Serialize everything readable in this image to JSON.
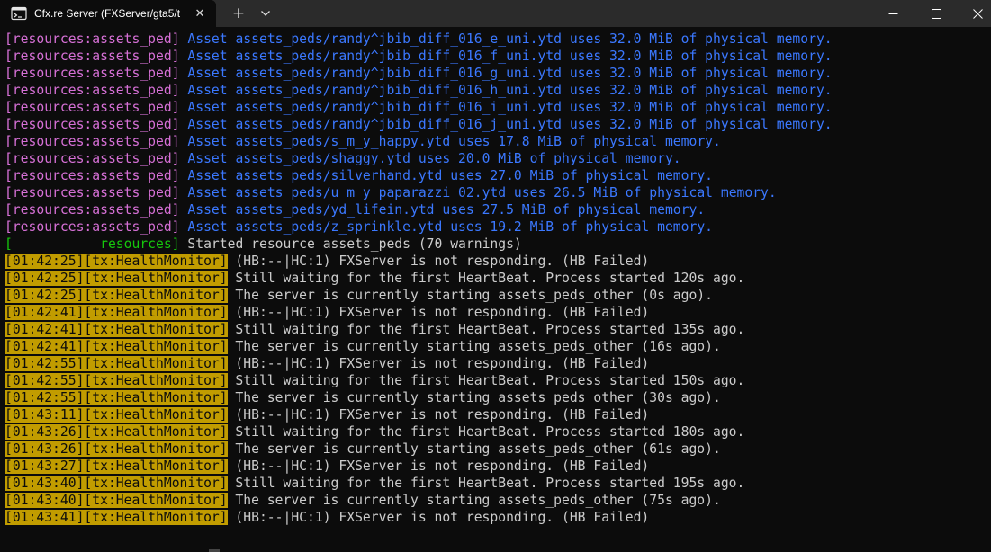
{
  "window": {
    "tab_title": "Cfx.re Server (FXServer/gta5/t",
    "close_glyph": "✕",
    "newtab_glyph": "+"
  },
  "colors": {
    "resource_tag": "#d670d6",
    "info_message": "#3b78ff",
    "started_tag": "#16c60c",
    "health_tag_bg": "#c19c00",
    "default_text": "#cccccc",
    "background": "#0c0c0c"
  },
  "icons": {
    "terminal": "terminal-icon",
    "close": "close-icon",
    "plus": "plus-icon",
    "chevron": "chevron-down-icon",
    "minimize": "minimize-icon",
    "maximize": "maximize-icon",
    "window_close": "window-close-icon"
  },
  "log": [
    {
      "tag": "[resources:assets_ped]",
      "tag_style": "res",
      "text": " Asset assets_peds/randy^jbib_diff_016_e_uni.ytd uses 32.0 MiB of physical memory.",
      "text_style": "blue"
    },
    {
      "tag": "[resources:assets_ped]",
      "tag_style": "res",
      "text": " Asset assets_peds/randy^jbib_diff_016_f_uni.ytd uses 32.0 MiB of physical memory.",
      "text_style": "blue"
    },
    {
      "tag": "[resources:assets_ped]",
      "tag_style": "res",
      "text": " Asset assets_peds/randy^jbib_diff_016_g_uni.ytd uses 32.0 MiB of physical memory.",
      "text_style": "blue"
    },
    {
      "tag": "[resources:assets_ped]",
      "tag_style": "res",
      "text": " Asset assets_peds/randy^jbib_diff_016_h_uni.ytd uses 32.0 MiB of physical memory.",
      "text_style": "blue"
    },
    {
      "tag": "[resources:assets_ped]",
      "tag_style": "res",
      "text": " Asset assets_peds/randy^jbib_diff_016_i_uni.ytd uses 32.0 MiB of physical memory.",
      "text_style": "blue"
    },
    {
      "tag": "[resources:assets_ped]",
      "tag_style": "res",
      "text": " Asset assets_peds/randy^jbib_diff_016_j_uni.ytd uses 32.0 MiB of physical memory.",
      "text_style": "blue"
    },
    {
      "tag": "[resources:assets_ped]",
      "tag_style": "res",
      "text": " Asset assets_peds/s_m_y_happy.ytd uses 17.8 MiB of physical memory.",
      "text_style": "blue"
    },
    {
      "tag": "[resources:assets_ped]",
      "tag_style": "res",
      "text": " Asset assets_peds/shaggy.ytd uses 20.0 MiB of physical memory.",
      "text_style": "blue"
    },
    {
      "tag": "[resources:assets_ped]",
      "tag_style": "res",
      "text": " Asset assets_peds/silverhand.ytd uses 27.0 MiB of physical memory.",
      "text_style": "blue"
    },
    {
      "tag": "[resources:assets_ped]",
      "tag_style": "res",
      "text": " Asset assets_peds/u_m_y_paparazzi_02.ytd uses 26.5 MiB of physical memory.",
      "text_style": "blue"
    },
    {
      "tag": "[resources:assets_ped]",
      "tag_style": "res",
      "text": " Asset assets_peds/yd_lifein.ytd uses 27.5 MiB of physical memory.",
      "text_style": "blue"
    },
    {
      "tag": "[resources:assets_ped]",
      "tag_style": "res",
      "text": " Asset assets_peds/z_sprinkle.ytd uses 19.2 MiB of physical memory.",
      "text_style": "blue"
    },
    {
      "tag": "[           resources]",
      "tag_style": "green",
      "text": " Started resource assets_peds (70 warnings)",
      "text_style": "white"
    },
    {
      "tag": "[01:42:25][tx:HealthMonitor]",
      "tag_style": "hm",
      "text": " (HB:--|HC:1) FXServer is not responding. (HB Failed)",
      "text_style": "white"
    },
    {
      "tag": "[01:42:25][tx:HealthMonitor]",
      "tag_style": "hm",
      "text": " Still waiting for the first HeartBeat. Process started 120s ago.",
      "text_style": "white"
    },
    {
      "tag": "[01:42:25][tx:HealthMonitor]",
      "tag_style": "hm",
      "text": " The server is currently starting assets_peds_other (0s ago).",
      "text_style": "white"
    },
    {
      "tag": "[01:42:41][tx:HealthMonitor]",
      "tag_style": "hm",
      "text": " (HB:--|HC:1) FXServer is not responding. (HB Failed)",
      "text_style": "white"
    },
    {
      "tag": "[01:42:41][tx:HealthMonitor]",
      "tag_style": "hm",
      "text": " Still waiting for the first HeartBeat. Process started 135s ago.",
      "text_style": "white"
    },
    {
      "tag": "[01:42:41][tx:HealthMonitor]",
      "tag_style": "hm",
      "text": " The server is currently starting assets_peds_other (16s ago).",
      "text_style": "white"
    },
    {
      "tag": "[01:42:55][tx:HealthMonitor]",
      "tag_style": "hm",
      "text": " (HB:--|HC:1) FXServer is not responding. (HB Failed)",
      "text_style": "white"
    },
    {
      "tag": "[01:42:55][tx:HealthMonitor]",
      "tag_style": "hm",
      "text": " Still waiting for the first HeartBeat. Process started 150s ago.",
      "text_style": "white"
    },
    {
      "tag": "[01:42:55][tx:HealthMonitor]",
      "tag_style": "hm",
      "text": " The server is currently starting assets_peds_other (30s ago).",
      "text_style": "white"
    },
    {
      "tag": "[01:43:11][tx:HealthMonitor]",
      "tag_style": "hm",
      "text": " (HB:--|HC:1) FXServer is not responding. (HB Failed)",
      "text_style": "white"
    },
    {
      "tag": "[01:43:26][tx:HealthMonitor]",
      "tag_style": "hm",
      "text": " Still waiting for the first HeartBeat. Process started 180s ago.",
      "text_style": "white"
    },
    {
      "tag": "[01:43:26][tx:HealthMonitor]",
      "tag_style": "hm",
      "text": " The server is currently starting assets_peds_other (61s ago).",
      "text_style": "white"
    },
    {
      "tag": "[01:43:27][tx:HealthMonitor]",
      "tag_style": "hm",
      "text": " (HB:--|HC:1) FXServer is not responding. (HB Failed)",
      "text_style": "white"
    },
    {
      "tag": "[01:43:40][tx:HealthMonitor]",
      "tag_style": "hm",
      "text": " Still waiting for the first HeartBeat. Process started 195s ago.",
      "text_style": "white"
    },
    {
      "tag": "[01:43:40][tx:HealthMonitor]",
      "tag_style": "hm",
      "text": " The server is currently starting assets_peds_other (75s ago).",
      "text_style": "white"
    },
    {
      "tag": "[01:43:41][tx:HealthMonitor]",
      "tag_style": "hm",
      "text": " (HB:--|HC:1) FXServer is not responding. (HB Failed)",
      "text_style": "white"
    }
  ]
}
